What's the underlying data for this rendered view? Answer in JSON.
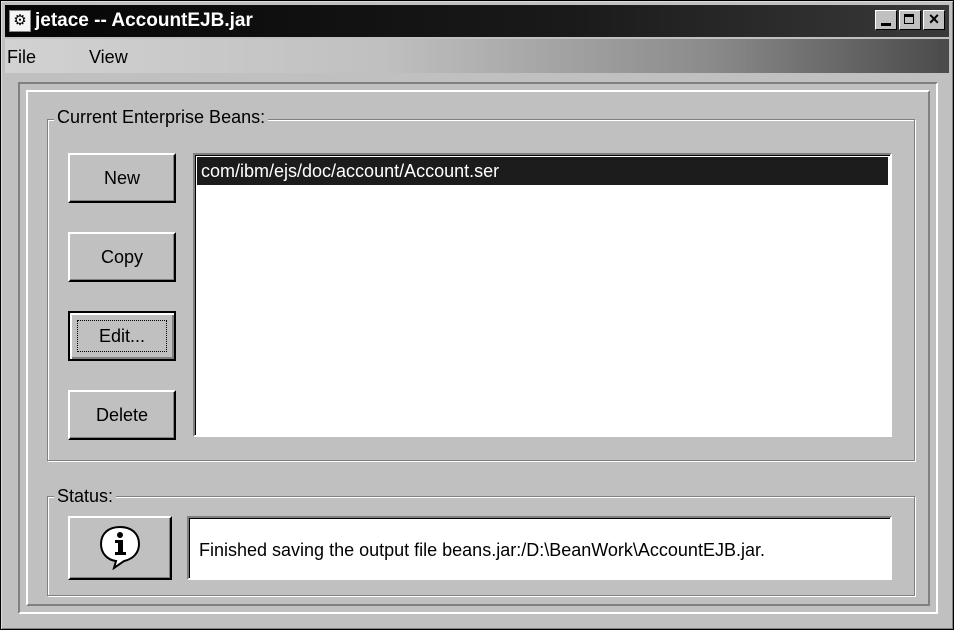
{
  "window": {
    "title": "jetace -- AccountEJB.jar",
    "app_icon": "jetace-app-icon",
    "controls": [
      "minimize-icon",
      "maximize-icon",
      "close-icon"
    ]
  },
  "menu": {
    "items": [
      "File",
      "View"
    ]
  },
  "beans_panel": {
    "legend": "Current Enterprise Beans:",
    "buttons": {
      "new": "New",
      "copy": "Copy",
      "edit": "Edit...",
      "delete": "Delete"
    },
    "list": {
      "items": [
        "com/ibm/ejs/doc/account/Account.ser"
      ],
      "selected_index": 0
    }
  },
  "status_panel": {
    "legend": "Status:",
    "icon": "info-icon",
    "message": "Finished saving the output file beans.jar:/D:\\BeanWork\\AccountEJB.jar."
  },
  "colors": {
    "selection_bg": "#1c1c1c",
    "face": "#c0c0c0"
  }
}
